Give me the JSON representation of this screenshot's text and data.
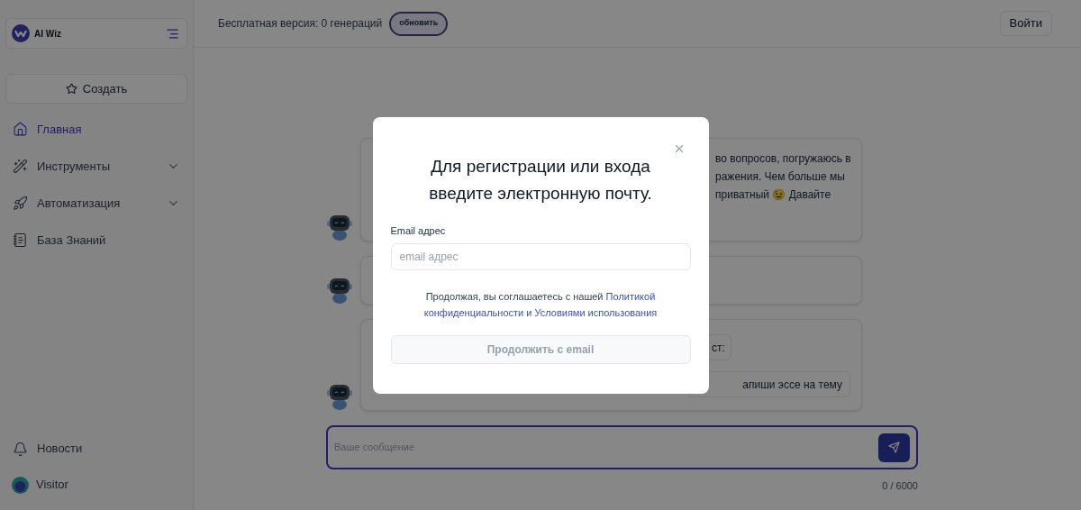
{
  "header": {
    "plan_text": "Бесплатная версия: 0 генераций",
    "upgrade_button": "обновить",
    "login_button": "Войти"
  },
  "sidebar": {
    "logo_text": "AI Wiz",
    "create_button": "Создать",
    "nav": [
      {
        "label": "Главная",
        "kind": "home",
        "selected": true,
        "expandable": false
      },
      {
        "label": "Инструменты",
        "kind": "wand",
        "selected": false,
        "expandable": true
      },
      {
        "label": "Автоматизация",
        "kind": "rocket",
        "selected": false,
        "expandable": true
      },
      {
        "label": "База Знаний",
        "kind": "book",
        "selected": false,
        "expandable": false
      }
    ],
    "news": "Новости",
    "user": "Visitor"
  },
  "chat": {
    "messages": [
      {
        "kind": "text",
        "lines": [
          "во вопросов, погружаюсь в",
          "ражения. Чем больше мы",
          "приватный 😉 Давайте"
        ]
      },
      {
        "kind": "short"
      },
      {
        "kind": "prompts",
        "chips": [
          "ст:",
          "апиши эссе на тему"
        ]
      }
    ],
    "composer": {
      "placeholder": "Ваше сообщение",
      "counter": "0 / 6000"
    }
  },
  "modal": {
    "title_lines": [
      "Для регистрации или входа",
      "введите электронную почту."
    ],
    "email_label": "Email адрес",
    "email_placeholder": "email адрес",
    "consent_text": "Продолжая, вы соглашаетесь с нашей",
    "consent_links": [
      "Политикой",
      "конфиденциальности и Условиями использования"
    ],
    "continue_button": "Продолжить с email",
    "continue_disabled": true
  }
}
